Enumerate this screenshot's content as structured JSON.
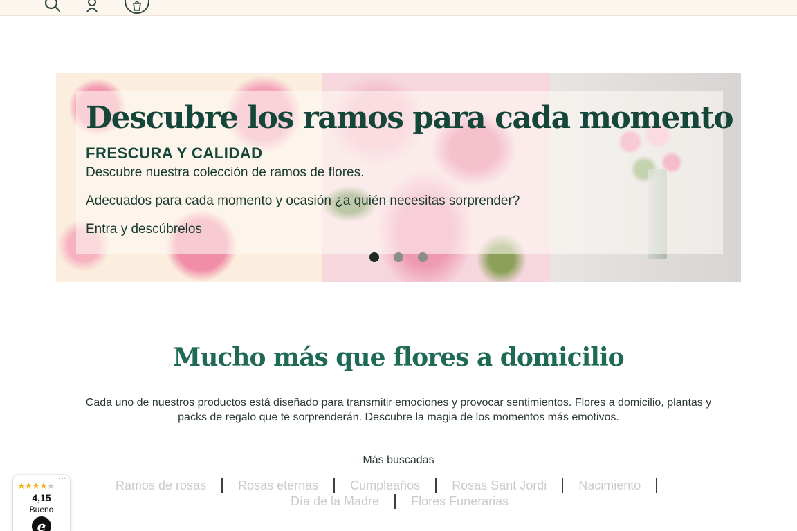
{
  "topbar": {
    "icons": [
      "search-icon",
      "user-icon",
      "cart-icon"
    ]
  },
  "hero": {
    "title": "Descubre los ramos para cada momento",
    "subtitle": "FRESCURA Y CALIDAD",
    "lines": [
      "Descubre nuestra colección de ramos de flores.",
      "Adecuados para cada momento y ocasión ¿a quién necesitas sorprender?",
      "Entra y descúbrelos"
    ],
    "slides": 3,
    "active_slide": 1
  },
  "section": {
    "title": "Mucho más que flores a domicilio",
    "text": "Cada uno de nuestros productos está diseñado para transmitir emociones y provocar sentimientos. Flores a domicilio, plantas y packs de regalo que te sorprenderán. Descubre la magia de los momentos más emotivos."
  },
  "popular": {
    "label": "Más buscadas",
    "links_row1": [
      "Ramos de rosas",
      "Rosas eternas",
      "Cumpleaños",
      "Rosas Sant Jordi",
      "Nacimiento"
    ],
    "links_row2": [
      "Día de la Madre",
      "Flores Funerarias"
    ]
  },
  "trust_badge": {
    "stars": 4,
    "score": "4,15",
    "rating": "Bueno",
    "logo": "e"
  },
  "colors": {
    "topbar_bg": "#fdf6ee",
    "title_green": "#14463a",
    "section_green": "#1f6a55",
    "link_gray": "#c9cdc9"
  }
}
